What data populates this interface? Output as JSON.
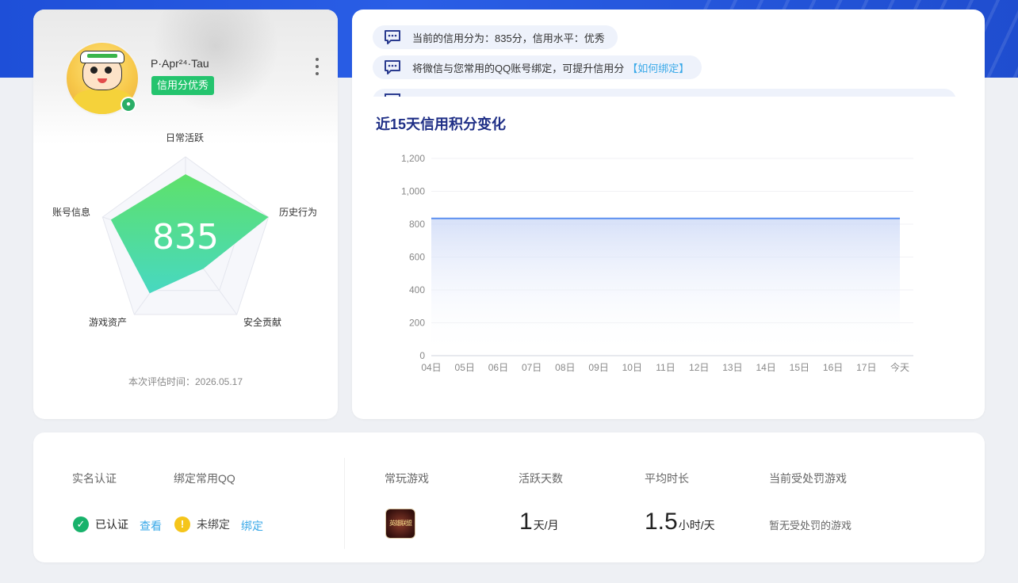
{
  "profile": {
    "nickname": "P·Apr²⁴·Tau",
    "badge": "信用分优秀",
    "score": "835",
    "eval_time": "本次评估时间：2026.05.17",
    "radar": {
      "axes": [
        "日常活跃",
        "历史行为",
        "安全贡献",
        "游戏资产",
        "账号信息"
      ],
      "values": [
        0.8,
        1.0,
        0.35,
        0.7,
        0.9
      ]
    }
  },
  "notices": [
    {
      "text": "当前的信用分为：835分，信用水平：优秀",
      "link": ""
    },
    {
      "text": "将微信与您常用的QQ账号绑定，可提升信用分",
      "link": "【如何绑定】"
    }
  ],
  "chart_title": "近15天信用积分变化",
  "chart_data": {
    "type": "area",
    "title": "近15天信用积分变化",
    "categories": [
      "04日",
      "05日",
      "06日",
      "07日",
      "08日",
      "09日",
      "10日",
      "11日",
      "12日",
      "13日",
      "14日",
      "15日",
      "16日",
      "17日",
      "今天"
    ],
    "values": [
      835,
      835,
      835,
      835,
      835,
      835,
      835,
      835,
      835,
      835,
      835,
      835,
      835,
      835,
      835
    ],
    "yticks": [
      "0",
      "200",
      "400",
      "600",
      "800",
      "1,000",
      "1,200"
    ],
    "ylim": [
      0,
      1200
    ],
    "grid": true,
    "line_color": "#5b8ff0"
  },
  "info": {
    "realname_head": "实名认证",
    "qq_head": "绑定常用QQ",
    "realname_status": "已认证",
    "realname_link": "查看",
    "qq_status": "未绑定",
    "qq_link": "绑定",
    "game_head": "常玩游戏",
    "game_icon_text": "英雄联盟",
    "days_head": "活跃天数",
    "days_value": "1",
    "days_unit": "天/月",
    "avg_head": "平均时长",
    "avg_value": "1.5",
    "avg_unit": "小时/天",
    "punish_head": "当前受处罚游戏",
    "punish_value": "暂无受处罚的游戏"
  },
  "colors": {
    "accent_green": "#24c46e",
    "link_blue": "#3aa9e8",
    "title_navy": "#1f2f86",
    "top_band": "#1e4fd8"
  }
}
